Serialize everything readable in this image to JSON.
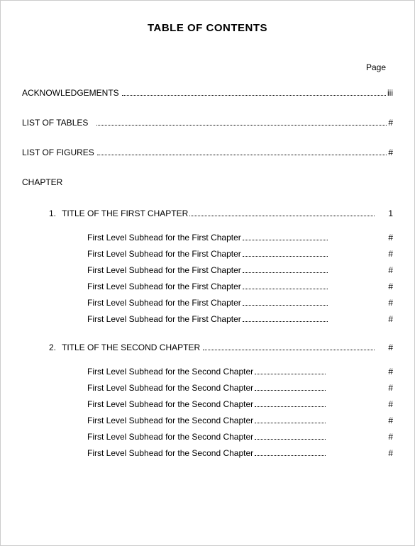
{
  "title": "TABLE OF CONTENTS",
  "pageHeader": "Page",
  "front": {
    "ack": {
      "label": "ACKNOWLEDGEMENTS",
      "page": "iii"
    },
    "lot": {
      "label": "LIST OF TABLES",
      "page": "#"
    },
    "lof": {
      "label": "LIST OF FIGURES",
      "page": "#"
    }
  },
  "chapterHeading": "CHAPTER",
  "chapters": [
    {
      "num": "1.",
      "title": "TITLE OF THE FIRST CHAPTER",
      "page": "1",
      "subs": [
        {
          "label": "First Level Subhead for the First Chapter",
          "page": "#"
        },
        {
          "label": "First Level Subhead for the First Chapter",
          "page": "#"
        },
        {
          "label": "First Level Subhead for the First Chapter",
          "page": "#"
        },
        {
          "label": "First Level Subhead for the First Chapter",
          "page": "#"
        },
        {
          "label": "First Level Subhead for the First Chapter",
          "page": "#"
        },
        {
          "label": "First Level Subhead for the First Chapter",
          "page": "#"
        }
      ]
    },
    {
      "num": "2.",
      "title": "TITLE OF THE SECOND CHAPTER",
      "page": "#",
      "subs": [
        {
          "label": "First Level Subhead for the Second Chapter",
          "page": "#"
        },
        {
          "label": "First Level Subhead for the Second Chapter",
          "page": "#"
        },
        {
          "label": "First Level Subhead for the Second Chapter",
          "page": "#"
        },
        {
          "label": "First Level Subhead for the Second Chapter",
          "page": "#"
        },
        {
          "label": "First Level Subhead for the Second Chapter",
          "page": "#"
        },
        {
          "label": "First Level Subhead for the Second Chapter",
          "page": "#"
        }
      ]
    }
  ]
}
